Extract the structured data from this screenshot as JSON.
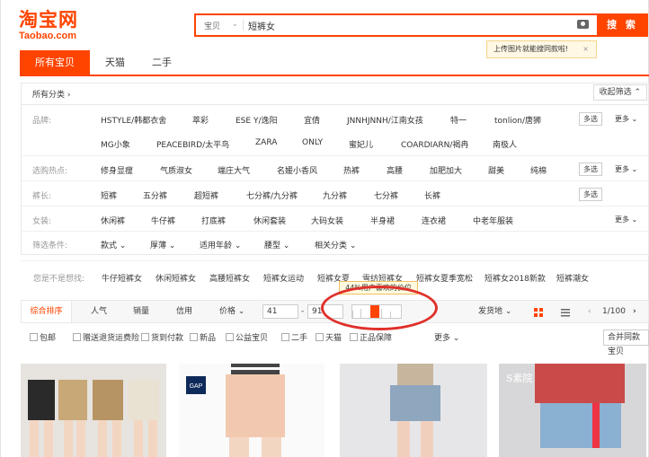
{
  "logo": {
    "text": "淘宝网",
    "sub": "Taobao.com"
  },
  "search": {
    "category": "宝贝",
    "query": "短裤女",
    "button": "搜 索"
  },
  "tip": {
    "text": "上传图片就能搜同款啦!",
    "close": "×"
  },
  "tabs": [
    {
      "label": "所有宝贝"
    },
    {
      "label": "天猫"
    },
    {
      "label": "二手"
    }
  ],
  "allcat": {
    "label": "所有分类 ›",
    "collapse": "收起筛选 ⌃"
  },
  "rows": [
    {
      "label": "品牌:",
      "options": [
        "HSTYLE/韩都衣舍",
        "萃彩",
        "ESE Y/逸阳",
        "宜倩",
        "JNNHJNNH/江南女孩",
        "特一",
        "tonlion/唐狮"
      ],
      "multi": "多选",
      "more": "更多 ⌄"
    },
    {
      "label": "",
      "options": [
        "MG小象",
        "PEACEBIRD/太平鸟",
        "ZARA",
        "ONLY",
        "蜜妃儿",
        "COARDIARN/褐冉",
        "南极人"
      ]
    },
    {
      "label": "选购热点:",
      "options": [
        "修身显瘦",
        "气质淑女",
        "端庄大气",
        "名媛小香风",
        "热裤",
        "高腰",
        "加肥加大",
        "甜美",
        "纯棉"
      ],
      "multi": "多选",
      "more": "更多 ⌄"
    },
    {
      "label": "裤长:",
      "options": [
        "短裤",
        "五分裤",
        "超短裤",
        "七分裤/九分裤",
        "九分裤",
        "七分裤",
        "长裤"
      ],
      "multi": "多选"
    },
    {
      "label": "女装:",
      "options": [
        "休闲裤",
        "牛仔裤",
        "打底裤",
        "休闲套装",
        "大码女装",
        "半身裙",
        "连衣裙",
        "中老年服装"
      ],
      "more": "更多 ⌄"
    },
    {
      "label": "筛选条件:",
      "options": [
        "款式 ⌄",
        "厚薄 ⌄",
        "适用年龄 ⌄",
        "腰型 ⌄",
        "相关分类 ⌄"
      ]
    }
  ],
  "suggest": {
    "label": "您是不是想找:",
    "items": [
      "牛仔短裤女",
      "休闲短裤女",
      "高腰短裤女",
      "短裤女运动",
      "短裤女夏",
      "雪纺短裤女",
      "短裤女夏季宽松",
      "短裤女2018新款",
      "短裤潮女"
    ]
  },
  "sortbar": {
    "items": [
      "综合排序",
      "人气",
      "销量",
      "信用",
      "价格 ⌄"
    ],
    "price_min": "41",
    "dash": "-",
    "price_max": "91",
    "tooltip": "44%用户喜欢的价位",
    "location": "发货地 ⌄",
    "page": "1/100"
  },
  "filters": {
    "items": [
      "包邮",
      "赠送退货运费险",
      "货到付款",
      "新品",
      "公益宝贝",
      "二手",
      "天猫",
      "正品保障"
    ],
    "more": "更多 ⌄",
    "merge": "合并同款宝贝"
  },
  "products": [
    {
      "brand": ""
    },
    {
      "brand": "GAP"
    },
    {
      "brand": ""
    },
    {
      "brand": "S素院"
    }
  ],
  "colors": {
    "accent": "#ff4400",
    "highlight": "#e0302a"
  }
}
